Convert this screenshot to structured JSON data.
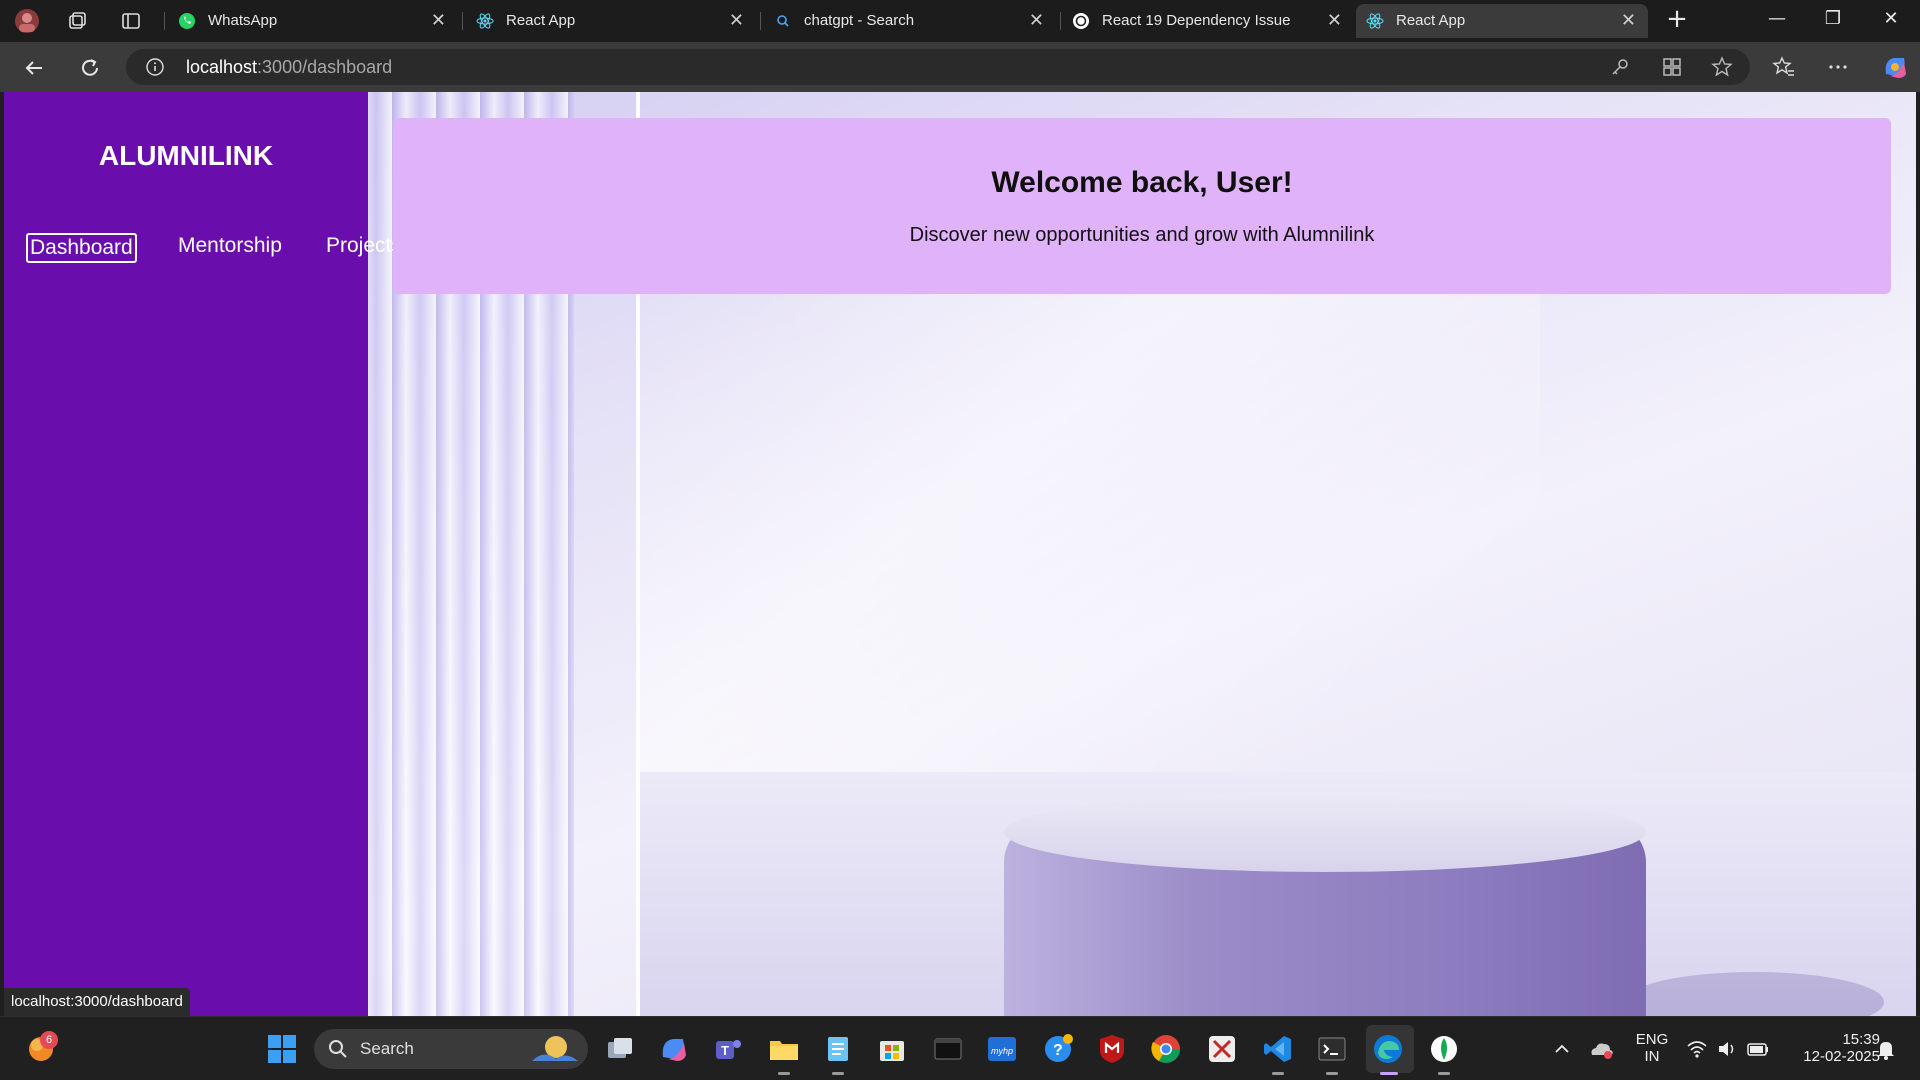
{
  "browser": {
    "tabs": [
      {
        "label": "WhatsApp",
        "icon": "whatsapp-icon",
        "active": false
      },
      {
        "label": "React App",
        "icon": "react-icon",
        "active": false
      },
      {
        "label": "chatgpt - Search",
        "icon": "search-icon",
        "active": false
      },
      {
        "label": "React 19 Dependency Issue",
        "icon": "chatgpt-icon",
        "active": false
      },
      {
        "label": "React App",
        "icon": "react-icon",
        "active": true
      }
    ],
    "new_tab_symbol": "+",
    "url_host": "localhost",
    "url_rest": ":3000/dashboard",
    "status_link": "localhost:3000/dashboard"
  },
  "app": {
    "brand": "ALUMNILINK",
    "nav": [
      {
        "label": "Dashboard",
        "active": true
      },
      {
        "label": "Mentorship",
        "active": false
      },
      {
        "label": "Projects",
        "active": false
      }
    ],
    "welcome": {
      "title": "Welcome back, User!",
      "subtitle": "Discover new opportunities and grow with Alumnilink"
    },
    "colors": {
      "sidebar": "#6a0dad",
      "welcome_card": "#dfb2fa"
    }
  },
  "taskbar": {
    "search_label": "Search",
    "widget_badge": "6",
    "lang_line1": "ENG",
    "lang_line2": "IN",
    "time": "15:39",
    "date": "12-02-2025"
  }
}
